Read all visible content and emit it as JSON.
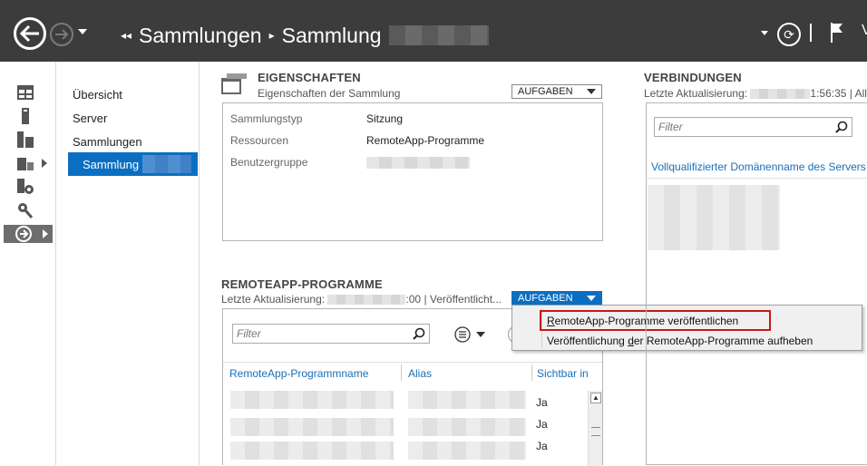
{
  "breadcrumb": {
    "root": "Sammlungen",
    "current": "Sammlung"
  },
  "nav": {
    "items": [
      "Übersicht",
      "Server",
      "Sammlungen"
    ],
    "selected": "Sammlung"
  },
  "properties": {
    "title": "EIGENSCHAFTEN",
    "subtitle": "Eigenschaften der Sammlung",
    "tasks_label": "AUFGABEN",
    "rows": [
      {
        "key": "Sammlungstyp",
        "value": "Sitzung"
      },
      {
        "key": "Ressourcen",
        "value": "RemoteApp-Programme"
      },
      {
        "key": "Benutzergruppe",
        "value": ""
      }
    ]
  },
  "remoteapp": {
    "title": "REMOTEAPP-PROGRAMME",
    "last_update_label": "Letzte Aktualisierung:",
    "last_update_tail": ":00 | Veröffentlicht...",
    "tasks_label": "AUFGABEN",
    "filter_placeholder": "Filter",
    "columns": [
      "RemoteApp-Programmname",
      "Alias",
      "Sichtbar in"
    ],
    "rows": [
      {
        "visible": "Ja"
      },
      {
        "visible": "Ja"
      },
      {
        "visible": "Ja"
      }
    ]
  },
  "menu": {
    "item1_prefix": "R",
    "item1_rest": "emoteApp-Programme veröffentlichen",
    "item2_prefix": "Veröffentlichung ",
    "item2_u": "d",
    "item2_rest": "er RemoteApp-Programme aufheben"
  },
  "connections": {
    "title": "VERBINDUNGEN",
    "last_update_label": "Letzte Aktualisierung:",
    "last_update_tail": "1:56:35 | All",
    "filter_placeholder": "Filter",
    "column": "Vollqualifizierter Domänenname des Servers"
  },
  "colors": {
    "topbar": "#3c3c3c",
    "accent": "#0a6fc2",
    "link": "#1a6fb5",
    "highlight": "#c51a1a"
  }
}
